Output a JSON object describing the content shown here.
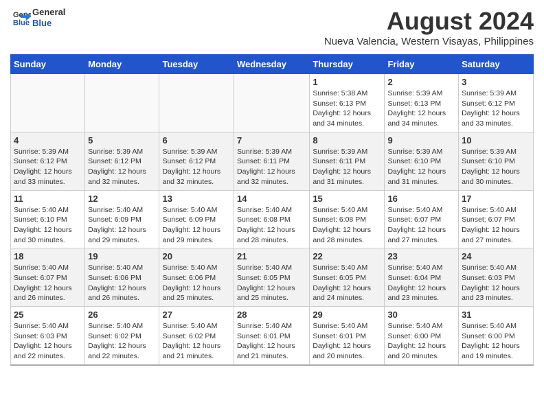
{
  "logo": {
    "line1": "General",
    "line2": "Blue"
  },
  "title": "August 2024",
  "location": "Nueva Valencia, Western Visayas, Philippines",
  "days_of_week": [
    "Sunday",
    "Monday",
    "Tuesday",
    "Wednesday",
    "Thursday",
    "Friday",
    "Saturday"
  ],
  "weeks": [
    [
      {
        "day": "",
        "info": ""
      },
      {
        "day": "",
        "info": ""
      },
      {
        "day": "",
        "info": ""
      },
      {
        "day": "",
        "info": ""
      },
      {
        "day": "1",
        "info": "Sunrise: 5:38 AM\nSunset: 6:13 PM\nDaylight: 12 hours\nand 34 minutes."
      },
      {
        "day": "2",
        "info": "Sunrise: 5:39 AM\nSunset: 6:13 PM\nDaylight: 12 hours\nand 34 minutes."
      },
      {
        "day": "3",
        "info": "Sunrise: 5:39 AM\nSunset: 6:12 PM\nDaylight: 12 hours\nand 33 minutes."
      }
    ],
    [
      {
        "day": "4",
        "info": "Sunrise: 5:39 AM\nSunset: 6:12 PM\nDaylight: 12 hours\nand 33 minutes."
      },
      {
        "day": "5",
        "info": "Sunrise: 5:39 AM\nSunset: 6:12 PM\nDaylight: 12 hours\nand 32 minutes."
      },
      {
        "day": "6",
        "info": "Sunrise: 5:39 AM\nSunset: 6:12 PM\nDaylight: 12 hours\nand 32 minutes."
      },
      {
        "day": "7",
        "info": "Sunrise: 5:39 AM\nSunset: 6:11 PM\nDaylight: 12 hours\nand 32 minutes."
      },
      {
        "day": "8",
        "info": "Sunrise: 5:39 AM\nSunset: 6:11 PM\nDaylight: 12 hours\nand 31 minutes."
      },
      {
        "day": "9",
        "info": "Sunrise: 5:39 AM\nSunset: 6:10 PM\nDaylight: 12 hours\nand 31 minutes."
      },
      {
        "day": "10",
        "info": "Sunrise: 5:39 AM\nSunset: 6:10 PM\nDaylight: 12 hours\nand 30 minutes."
      }
    ],
    [
      {
        "day": "11",
        "info": "Sunrise: 5:40 AM\nSunset: 6:10 PM\nDaylight: 12 hours\nand 30 minutes."
      },
      {
        "day": "12",
        "info": "Sunrise: 5:40 AM\nSunset: 6:09 PM\nDaylight: 12 hours\nand 29 minutes."
      },
      {
        "day": "13",
        "info": "Sunrise: 5:40 AM\nSunset: 6:09 PM\nDaylight: 12 hours\nand 29 minutes."
      },
      {
        "day": "14",
        "info": "Sunrise: 5:40 AM\nSunset: 6:08 PM\nDaylight: 12 hours\nand 28 minutes."
      },
      {
        "day": "15",
        "info": "Sunrise: 5:40 AM\nSunset: 6:08 PM\nDaylight: 12 hours\nand 28 minutes."
      },
      {
        "day": "16",
        "info": "Sunrise: 5:40 AM\nSunset: 6:07 PM\nDaylight: 12 hours\nand 27 minutes."
      },
      {
        "day": "17",
        "info": "Sunrise: 5:40 AM\nSunset: 6:07 PM\nDaylight: 12 hours\nand 27 minutes."
      }
    ],
    [
      {
        "day": "18",
        "info": "Sunrise: 5:40 AM\nSunset: 6:07 PM\nDaylight: 12 hours\nand 26 minutes."
      },
      {
        "day": "19",
        "info": "Sunrise: 5:40 AM\nSunset: 6:06 PM\nDaylight: 12 hours\nand 26 minutes."
      },
      {
        "day": "20",
        "info": "Sunrise: 5:40 AM\nSunset: 6:06 PM\nDaylight: 12 hours\nand 25 minutes."
      },
      {
        "day": "21",
        "info": "Sunrise: 5:40 AM\nSunset: 6:05 PM\nDaylight: 12 hours\nand 25 minutes."
      },
      {
        "day": "22",
        "info": "Sunrise: 5:40 AM\nSunset: 6:05 PM\nDaylight: 12 hours\nand 24 minutes."
      },
      {
        "day": "23",
        "info": "Sunrise: 5:40 AM\nSunset: 6:04 PM\nDaylight: 12 hours\nand 23 minutes."
      },
      {
        "day": "24",
        "info": "Sunrise: 5:40 AM\nSunset: 6:03 PM\nDaylight: 12 hours\nand 23 minutes."
      }
    ],
    [
      {
        "day": "25",
        "info": "Sunrise: 5:40 AM\nSunset: 6:03 PM\nDaylight: 12 hours\nand 22 minutes."
      },
      {
        "day": "26",
        "info": "Sunrise: 5:40 AM\nSunset: 6:02 PM\nDaylight: 12 hours\nand 22 minutes."
      },
      {
        "day": "27",
        "info": "Sunrise: 5:40 AM\nSunset: 6:02 PM\nDaylight: 12 hours\nand 21 minutes."
      },
      {
        "day": "28",
        "info": "Sunrise: 5:40 AM\nSunset: 6:01 PM\nDaylight: 12 hours\nand 21 minutes."
      },
      {
        "day": "29",
        "info": "Sunrise: 5:40 AM\nSunset: 6:01 PM\nDaylight: 12 hours\nand 20 minutes."
      },
      {
        "day": "30",
        "info": "Sunrise: 5:40 AM\nSunset: 6:00 PM\nDaylight: 12 hours\nand 20 minutes."
      },
      {
        "day": "31",
        "info": "Sunrise: 5:40 AM\nSunset: 6:00 PM\nDaylight: 12 hours\nand 19 minutes."
      }
    ]
  ]
}
